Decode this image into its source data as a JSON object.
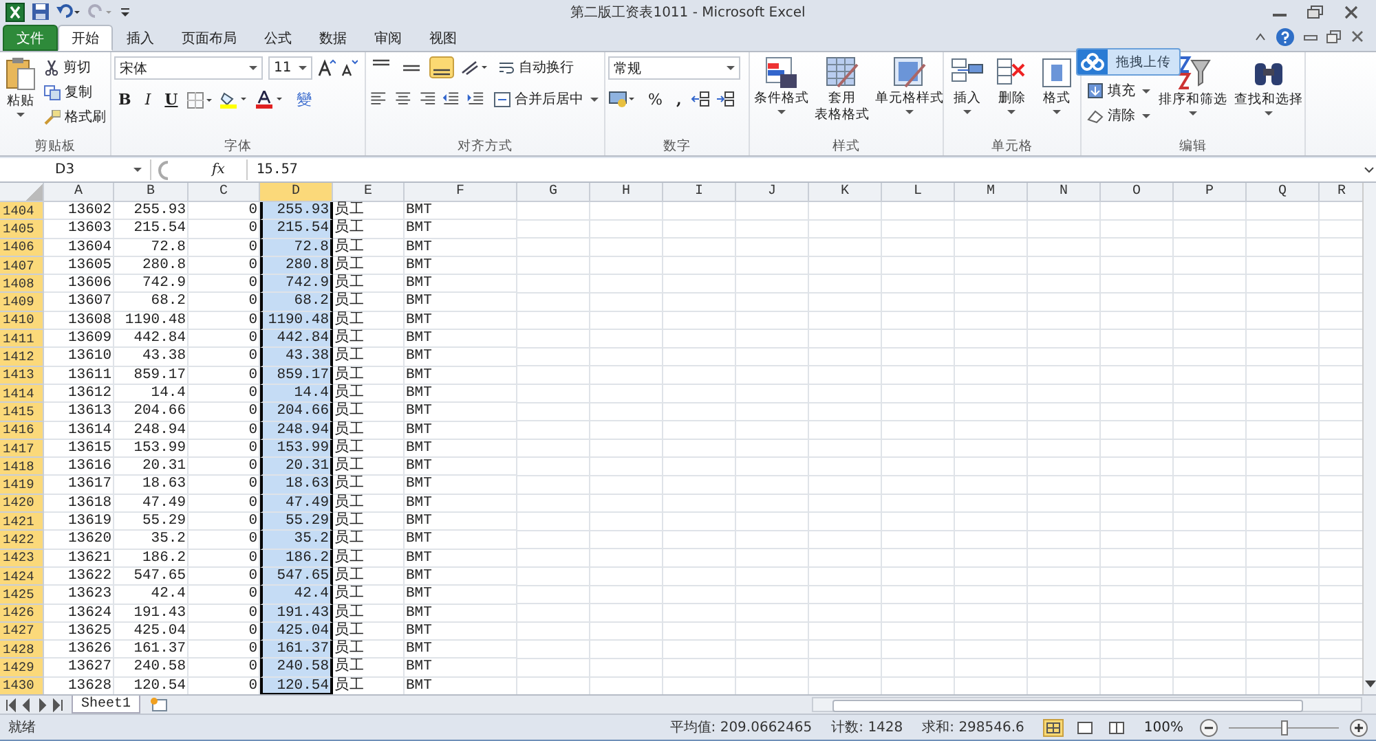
{
  "window": {
    "title": "第二版工资表1011 - Microsoft Excel"
  },
  "file_tab": "文件",
  "tabs": [
    {
      "label": "开始",
      "selected": true
    },
    {
      "label": "插入",
      "selected": false
    },
    {
      "label": "页面布局",
      "selected": false
    },
    {
      "label": "公式",
      "selected": false
    },
    {
      "label": "数据",
      "selected": false
    },
    {
      "label": "审阅",
      "selected": false
    },
    {
      "label": "视图",
      "selected": false
    }
  ],
  "ribbon": {
    "clipboard": {
      "label": "剪贴板",
      "paste": "粘贴",
      "cut": "剪切",
      "copy": "复制",
      "format_painter": "格式刷"
    },
    "font": {
      "label": "字体",
      "font_name": "宋体",
      "font_size": "11",
      "bold": "B",
      "italic": "I",
      "underline": "U",
      "phonetic": "變"
    },
    "alignment": {
      "label": "对齐方式",
      "wrap_text": "自动换行",
      "merge_center": "合并后居中",
      "bottom_align_on": true
    },
    "number": {
      "label": "数字",
      "format": "常规",
      "percent": "%",
      "comma": ","
    },
    "styles": {
      "label": "样式",
      "conditional": "条件格式",
      "table_format": [
        "套用",
        "表格格式"
      ],
      "cell_styles": "单元格样式"
    },
    "cells": {
      "label": "单元格",
      "insert": "插入",
      "delete": "删除",
      "format": "格式"
    },
    "editing": {
      "label": "编辑",
      "fill": "填充",
      "clear": "清除",
      "sort_filter": "排序和筛选",
      "find_select": "查找和选择"
    }
  },
  "upload_button": "拖拽上传",
  "formula_bar": {
    "name_box": "D3",
    "fx": "fx",
    "value": "15.57"
  },
  "columns": [
    {
      "label": "A",
      "selected": false
    },
    {
      "label": "B",
      "selected": false
    },
    {
      "label": "C",
      "selected": false
    },
    {
      "label": "D",
      "selected": true
    },
    {
      "label": "E",
      "selected": false
    },
    {
      "label": "F",
      "selected": false
    },
    {
      "label": "G",
      "selected": false
    },
    {
      "label": "H",
      "selected": false
    },
    {
      "label": "I",
      "selected": false
    },
    {
      "label": "J",
      "selected": false
    },
    {
      "label": "K",
      "selected": false
    },
    {
      "label": "L",
      "selected": false
    },
    {
      "label": "M",
      "selected": false
    },
    {
      "label": "N",
      "selected": false
    },
    {
      "label": "O",
      "selected": false
    },
    {
      "label": "P",
      "selected": false
    },
    {
      "label": "Q",
      "selected": false
    },
    {
      "label": "R",
      "selected": false
    }
  ],
  "rows": [
    {
      "header": "1404",
      "selected": true,
      "cells": [
        "13602",
        "255.93",
        "0",
        "255.93",
        "员工",
        "BMT"
      ]
    },
    {
      "header": "1405",
      "selected": true,
      "cells": [
        "13603",
        "215.54",
        "0",
        "215.54",
        "员工",
        "BMT"
      ]
    },
    {
      "header": "1406",
      "selected": true,
      "cells": [
        "13604",
        "72.8",
        "0",
        "72.8",
        "员工",
        "BMT"
      ]
    },
    {
      "header": "1407",
      "selected": true,
      "cells": [
        "13605",
        "280.8",
        "0",
        "280.8",
        "员工",
        "BMT"
      ]
    },
    {
      "header": "1408",
      "selected": true,
      "cells": [
        "13606",
        "742.9",
        "0",
        "742.9",
        "员工",
        "BMT"
      ]
    },
    {
      "header": "1409",
      "selected": true,
      "cells": [
        "13607",
        "68.2",
        "0",
        "68.2",
        "员工",
        "BMT"
      ]
    },
    {
      "header": "1410",
      "selected": true,
      "cells": [
        "13608",
        "1190.48",
        "0",
        "1190.48",
        "员工",
        "BMT"
      ]
    },
    {
      "header": "1411",
      "selected": true,
      "cells": [
        "13609",
        "442.84",
        "0",
        "442.84",
        "员工",
        "BMT"
      ]
    },
    {
      "header": "1412",
      "selected": true,
      "cells": [
        "13610",
        "43.38",
        "0",
        "43.38",
        "员工",
        "BMT"
      ]
    },
    {
      "header": "1413",
      "selected": true,
      "cells": [
        "13611",
        "859.17",
        "0",
        "859.17",
        "员工",
        "BMT"
      ]
    },
    {
      "header": "1414",
      "selected": true,
      "cells": [
        "13612",
        "14.4",
        "0",
        "14.4",
        "员工",
        "BMT"
      ]
    },
    {
      "header": "1415",
      "selected": true,
      "cells": [
        "13613",
        "204.66",
        "0",
        "204.66",
        "员工",
        "BMT"
      ]
    },
    {
      "header": "1416",
      "selected": true,
      "cells": [
        "13614",
        "248.94",
        "0",
        "248.94",
        "员工",
        "BMT"
      ]
    },
    {
      "header": "1417",
      "selected": true,
      "cells": [
        "13615",
        "153.99",
        "0",
        "153.99",
        "员工",
        "BMT"
      ]
    },
    {
      "header": "1418",
      "selected": true,
      "cells": [
        "13616",
        "20.31",
        "0",
        "20.31",
        "员工",
        "BMT"
      ]
    },
    {
      "header": "1419",
      "selected": true,
      "cells": [
        "13617",
        "18.63",
        "0",
        "18.63",
        "员工",
        "BMT"
      ]
    },
    {
      "header": "1420",
      "selected": true,
      "cells": [
        "13618",
        "47.49",
        "0",
        "47.49",
        "员工",
        "BMT"
      ]
    },
    {
      "header": "1421",
      "selected": true,
      "cells": [
        "13619",
        "55.29",
        "0",
        "55.29",
        "员工",
        "BMT"
      ]
    },
    {
      "header": "1422",
      "selected": true,
      "cells": [
        "13620",
        "35.2",
        "0",
        "35.2",
        "员工",
        "BMT"
      ]
    },
    {
      "header": "1423",
      "selected": true,
      "cells": [
        "13621",
        "186.2",
        "0",
        "186.2",
        "员工",
        "BMT"
      ]
    },
    {
      "header": "1424",
      "selected": true,
      "cells": [
        "13622",
        "547.65",
        "0",
        "547.65",
        "员工",
        "BMT"
      ]
    },
    {
      "header": "1425",
      "selected": true,
      "cells": [
        "13623",
        "42.4",
        "0",
        "42.4",
        "员工",
        "BMT"
      ]
    },
    {
      "header": "1426",
      "selected": true,
      "cells": [
        "13624",
        "191.43",
        "0",
        "191.43",
        "员工",
        "BMT"
      ]
    },
    {
      "header": "1427",
      "selected": true,
      "cells": [
        "13625",
        "425.04",
        "0",
        "425.04",
        "员工",
        "BMT"
      ]
    },
    {
      "header": "1428",
      "selected": true,
      "cells": [
        "13626",
        "161.37",
        "0",
        "161.37",
        "员工",
        "BMT"
      ]
    },
    {
      "header": "1429",
      "selected": true,
      "cells": [
        "13627",
        "240.58",
        "0",
        "240.58",
        "员工",
        "BMT"
      ]
    },
    {
      "header": "1430",
      "selected": true,
      "cells": [
        "13628",
        "120.54",
        "0",
        "120.54",
        "员工",
        "BMT"
      ]
    }
  ],
  "sheets": [
    {
      "label": "Sheet1",
      "selected": true
    }
  ],
  "status_bar": {
    "ready": "就绪",
    "average": "平均值: 209.0662465",
    "count": "计数: 1428",
    "sum": "求和: 298546.6",
    "zoom": "100%",
    "zoom_slider": {
      "level": 0.5
    }
  }
}
